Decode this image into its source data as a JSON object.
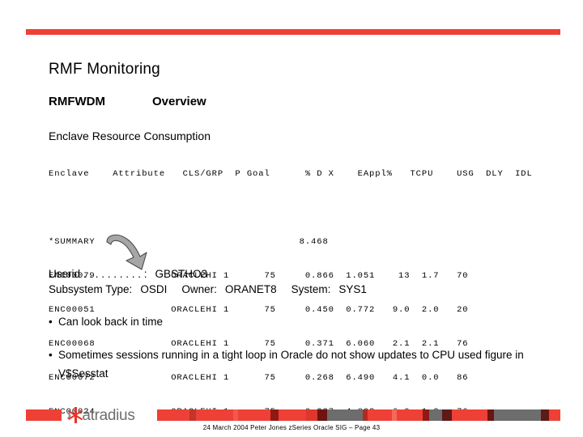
{
  "theme": {
    "accent_red": "#ee4036",
    "dark_red": "#8f1a14",
    "gray_bar": "#6d6d6d",
    "arrow_fill": "#a6a6a6",
    "logo_gray": "#6e6e6e",
    "logo_red": "#e8332a"
  },
  "slide": {
    "title": "RMF Monitoring",
    "subhead_left": "RMFWDM",
    "subhead_right": "Overview",
    "section_heading": "Enclave Resource Consumption"
  },
  "report": {
    "columns": [
      "Enclave",
      "Attribute",
      "CLS/GRP",
      "P",
      "Goal",
      "%",
      "D",
      "X",
      "EAppl%",
      "TCPU",
      "USG",
      "DLY",
      "IDL"
    ],
    "header_line": "Enclave    Attribute   CLS/GRP  P Goal      % D X    EAppl%   TCPU    USG  DLY  IDL",
    "rows": [
      {
        "enclave": "*SUMMARY",
        "attribute": "",
        "cls_grp": "",
        "p": "",
        "goal": "",
        "pct": "",
        "d": "",
        "x": "",
        "eappl": "8.468",
        "tcpu": "",
        "usg": "",
        "dly": "",
        "idl": "",
        "line": "*SUMMARY                                   8.468"
      },
      {
        "enclave": "ENC00079",
        "attribute": "",
        "cls_grp": "ORACLEHI",
        "p": "1",
        "goal": "",
        "pct": "75",
        "d": "",
        "x": "",
        "eappl": "0.866",
        "tcpu": "1.051",
        "usg": "13",
        "dly": "1.7",
        "idl": "70",
        "line": "ENC00079             ORACLEHI 1      75     0.866  1.051    13  1.7   70"
      },
      {
        "enclave": "ENC00051",
        "attribute": "",
        "cls_grp": "ORACLEHI",
        "p": "1",
        "goal": "",
        "pct": "75",
        "d": "",
        "x": "",
        "eappl": "0.450",
        "tcpu": "0.772",
        "usg": "9.0",
        "dly": "2.0",
        "idl": "20",
        "line": "ENC00051             ORACLEHI 1      75     0.450  0.772   9.0  2.0   20"
      },
      {
        "enclave": "ENC00068",
        "attribute": "",
        "cls_grp": "ORACLEHI",
        "p": "1",
        "goal": "",
        "pct": "75",
        "d": "",
        "x": "",
        "eappl": "0.371",
        "tcpu": "6.060",
        "usg": "2.1",
        "dly": "2.1",
        "idl": "76",
        "line": "ENC00068             ORACLEHI 1      75     0.371  6.060   2.1  2.1   76"
      },
      {
        "enclave": "ENC00072",
        "attribute": "",
        "cls_grp": "ORACLEHI",
        "p": "1",
        "goal": "",
        "pct": "75",
        "d": "",
        "x": "",
        "eappl": "0.268",
        "tcpu": "6.490",
        "usg": "4.1",
        "dly": "0.0",
        "idl": "86",
        "line": "ENC00072             ORACLEHI 1      75     0.268  6.490   4.1  0.0   86"
      },
      {
        "enclave": "ENC00024",
        "attribute": "",
        "cls_grp": "ORACLEHI",
        "p": "1",
        "goal": "",
        "pct": "75",
        "d": "",
        "x": "",
        "eappl": "0.237",
        "tcpu": "4.803",
        "usg": "6.0",
        "dly": "1.2",
        "idl": "76",
        "line": "ENC00024             ORACLEHI 1      75     0.237  4.803   6.0  1.2   76"
      }
    ]
  },
  "details": {
    "userid_label": "Userid . . . . . . . . . . :",
    "userid_value": "GBSTHO3",
    "subsystem_label": "Subsystem Type:",
    "subsystem_value": "OSDI",
    "owner_label": "Owner:",
    "owner_value": "ORANET8",
    "system_label": "System:",
    "system_value": "SYS1"
  },
  "bullets": [
    {
      "marker": "•",
      "text": "Can look back in time"
    },
    {
      "marker": "•",
      "text": "Sometimes sessions running in a tight loop in Oracle do not show updates to CPU used figure in V$Sesstat"
    }
  ],
  "footer": {
    "logo_chevron": "›",
    "logo_word": "atradius",
    "credit": "24 March 2004 Peter Jones  zSeries Oracle SIG  – Page 43"
  }
}
